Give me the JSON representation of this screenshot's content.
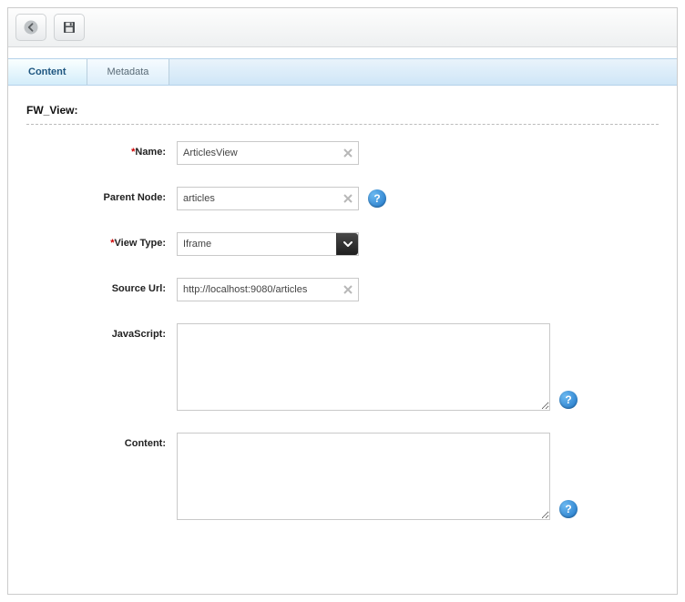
{
  "toolbar": {
    "back_label": "Back",
    "save_label": "Save"
  },
  "tabs": {
    "content_label": "Content",
    "metadata_label": "Metadata"
  },
  "section": {
    "title": "FW_View:"
  },
  "form": {
    "name": {
      "label": "Name:",
      "value": "ArticlesView"
    },
    "parent_node": {
      "label": "Parent Node:",
      "value": "articles"
    },
    "view_type": {
      "label": "View Type:",
      "selected": "Iframe"
    },
    "source_url": {
      "label": "Source Url:",
      "value": "http://localhost:9080/articles"
    },
    "javascript": {
      "label": "JavaScript:",
      "value": ""
    },
    "content": {
      "label": "Content:",
      "value": ""
    }
  }
}
